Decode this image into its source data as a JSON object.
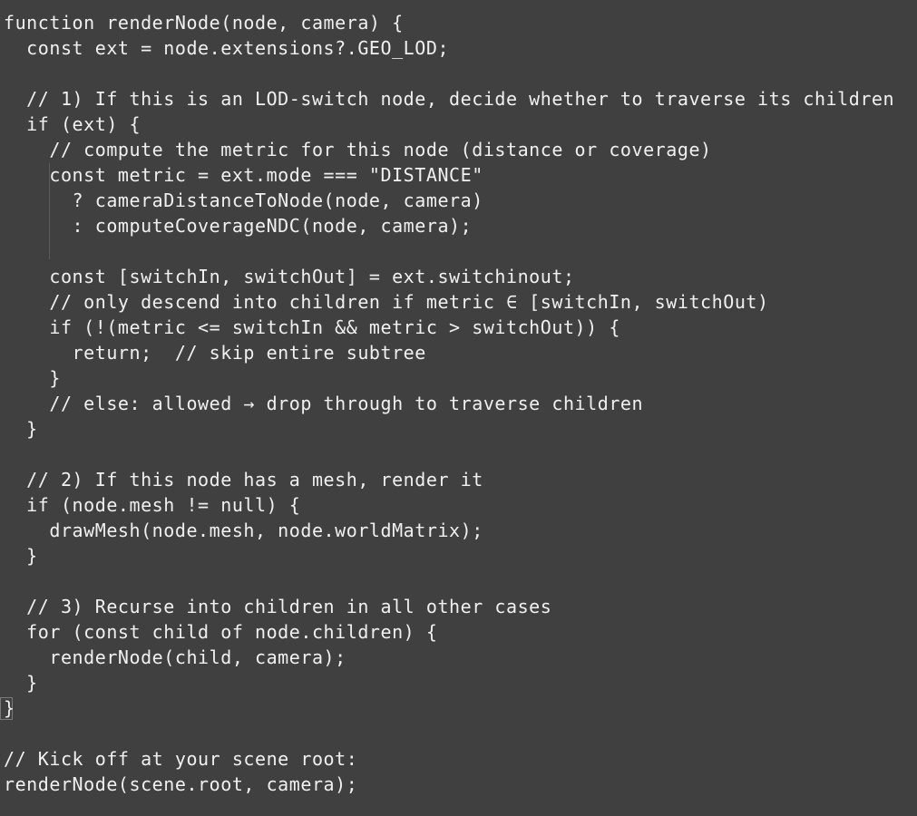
{
  "editor": {
    "lines": [
      "function renderNode(node, camera) {",
      "  const ext = node.extensions?.GEO_LOD;",
      "",
      "  // 1) If this is an LOD-switch node, decide whether to traverse its children",
      "  if (ext) {",
      "    // compute the metric for this node (distance or coverage)",
      "    const metric = ext.mode === \"DISTANCE\"",
      "      ? cameraDistanceToNode(node, camera)",
      "      : computeCoverageNDC(node, camera);",
      "",
      "    const [switchIn, switchOut] = ext.switchinout;",
      "    // only descend into children if metric ∈ [switchIn, switchOut)",
      "    if (!(metric <= switchIn && metric > switchOut)) {",
      "      return;  // skip entire subtree",
      "    }",
      "    // else: allowed → drop through to traverse children",
      "  }",
      "",
      "  // 2) If this node has a mesh, render it",
      "  if (node.mesh != null) {",
      "    drawMesh(node.mesh, node.worldMatrix);",
      "  }",
      "",
      "  // 3) Recurse into children in all other cases",
      "  for (const child of node.children) {",
      "    renderNode(child, camera);",
      "  }",
      "}",
      "",
      "// Kick off at your scene root:",
      "renderNode(scene.root, camera);"
    ]
  },
  "colors": {
    "background": "#404040",
    "text": "#f0f0f0"
  }
}
